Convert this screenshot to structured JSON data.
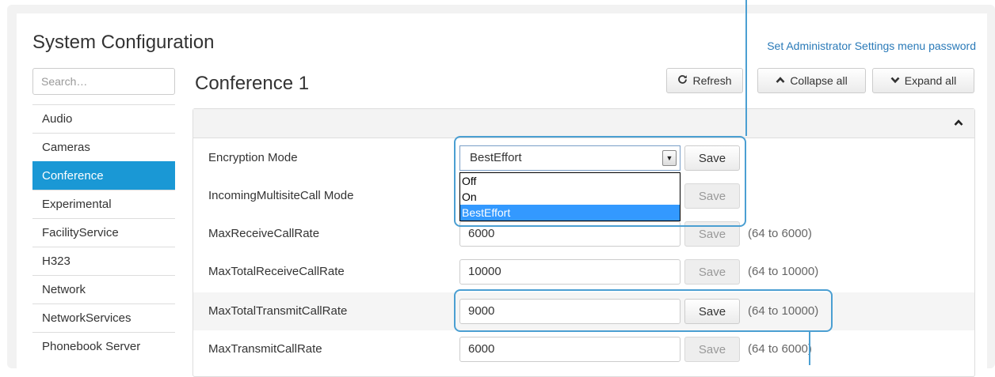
{
  "page": {
    "title": "System Configuration",
    "admin_link": "Set Administrator Settings menu password",
    "search_placeholder": "Search…"
  },
  "sidebar": {
    "items": [
      {
        "label": "Audio"
      },
      {
        "label": "Cameras"
      },
      {
        "label": "Conference",
        "active": true
      },
      {
        "label": "Experimental"
      },
      {
        "label": "FacilityService"
      },
      {
        "label": "H323"
      },
      {
        "label": "Network"
      },
      {
        "label": "NetworkServices"
      },
      {
        "label": "Phonebook Server"
      }
    ]
  },
  "main": {
    "section_title": "Conference 1",
    "toolbar": {
      "refresh": "Refresh",
      "collapse_all": "Collapse all",
      "expand_all": "Expand all"
    },
    "rows": [
      {
        "label": "Encryption Mode",
        "type": "select",
        "value": "BestEffort",
        "save": "Save",
        "save_enabled": true
      },
      {
        "label": "IncomingMultisiteCall Mode",
        "type": "select",
        "value": "",
        "save": "Save",
        "save_enabled": false
      },
      {
        "label": "MaxReceiveCallRate",
        "type": "text",
        "value": "6000",
        "save": "Save",
        "save_enabled": false,
        "range": "(64 to 6000)"
      },
      {
        "label": "MaxTotalReceiveCallRate",
        "type": "text",
        "value": "10000",
        "save": "Save",
        "save_enabled": false,
        "range": "(64 to 10000)"
      },
      {
        "label": "MaxTotalTransmitCallRate",
        "type": "text",
        "value": "9000",
        "save": "Save",
        "save_enabled": true,
        "range": "(64 to 10000)",
        "highlighted": true
      },
      {
        "label": "MaxTransmitCallRate",
        "type": "text",
        "value": "6000",
        "save": "Save",
        "save_enabled": false,
        "range": "(64 to 6000)"
      }
    ],
    "dropdown_options": [
      {
        "label": "Off"
      },
      {
        "label": "On"
      },
      {
        "label": "BestEffort",
        "selected": true
      }
    ]
  },
  "colors": {
    "accent": "#1a98d5",
    "link": "#2a7ab8",
    "callout": "#4b9fd2",
    "dropdown_selected": "#3399ff"
  },
  "icons": {
    "refresh": "refresh-icon",
    "collapse": "chevron-up-icon",
    "expand": "chevron-down-icon"
  }
}
